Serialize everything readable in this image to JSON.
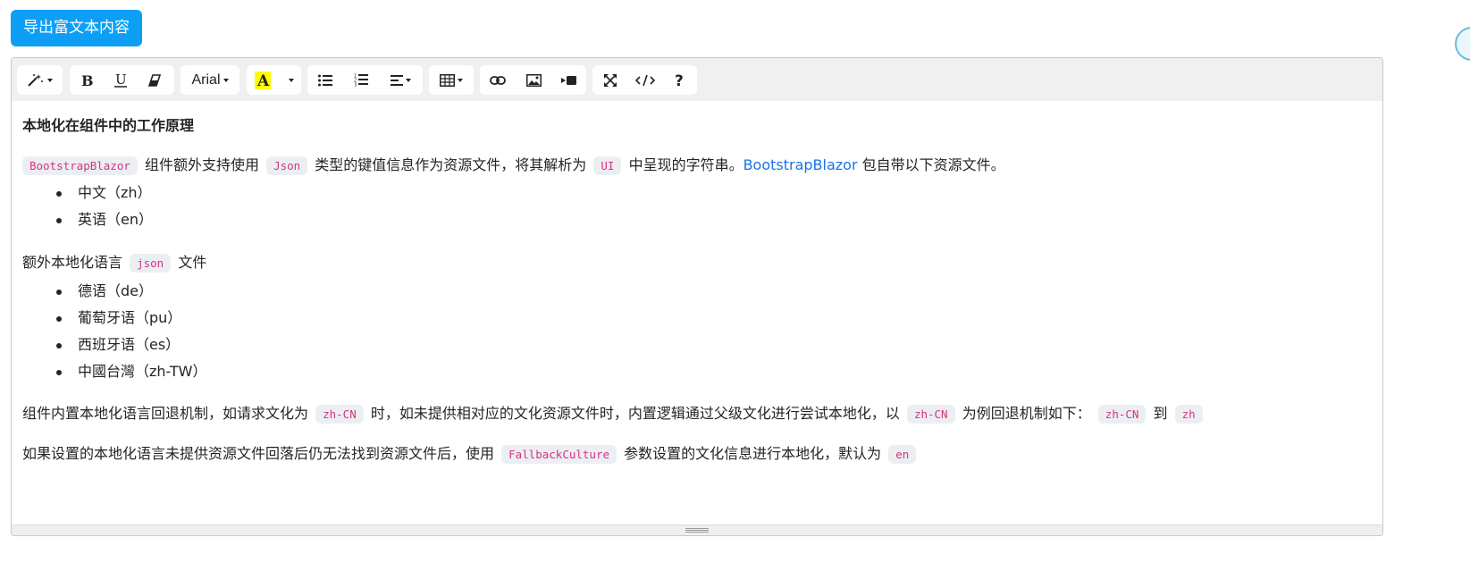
{
  "export_button": "导出富文本内容",
  "toolbar": {
    "font_name": "Arial",
    "icons": [
      "magic-icon",
      "bold-icon",
      "underline-icon",
      "eraser-icon",
      "font-color-icon",
      "unordered-list-icon",
      "ordered-list-icon",
      "align-icon",
      "table-icon",
      "link-icon",
      "picture-icon",
      "video-icon",
      "fullscreen-icon",
      "code-view-icon",
      "help-icon"
    ],
    "highlight_color": "#ffff00"
  },
  "content": {
    "heading": "本地化在组件中的工作原理",
    "p1": {
      "c1": "BootstrapBlazor",
      "t1": "组件额外支持使用",
      "c2": "Json",
      "t2": "类型的键值信息作为资源文件，将其解析为",
      "c3": "UI",
      "t3": "中呈现的字符串。",
      "link": "BootstrapBlazor",
      "t4": "包自带以下资源文件。"
    },
    "list1": [
      "中文（zh）",
      "英语（en）"
    ],
    "p2": {
      "t1": "额外本地化语言",
      "c1": "json",
      "t2": "文件"
    },
    "list2": [
      "德语（de）",
      "葡萄牙语（pu）",
      "西班牙语（es）",
      "中國台灣（zh-TW）"
    ],
    "p3": {
      "t1": "组件内置本地化语言回退机制，如请求文化为",
      "c1": "zh-CN",
      "t2": "时，如未提供相对应的文化资源文件时，内置逻辑通过父级文化进行尝试本地化，以",
      "c2": "zh-CN",
      "t3": "为例回退机制如下：",
      "c3": "zh-CN",
      "t4": "到",
      "c4": "zh"
    },
    "p4": {
      "t1": "如果设置的本地化语言未提供资源文件回落后仍无法找到资源文件后，使用",
      "c1": "FallbackCulture",
      "t2": "参数设置的文化信息进行本地化，默认为",
      "c2": "en"
    }
  },
  "colors": {
    "primary": "#0d9ff5",
    "code": "#d63384",
    "link": "#1a73e8"
  }
}
